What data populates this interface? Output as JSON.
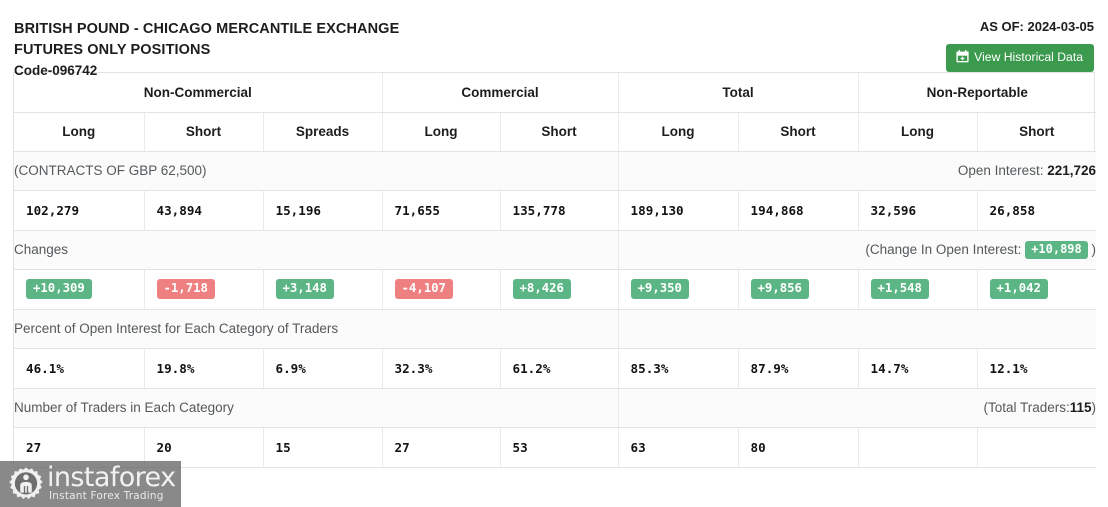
{
  "header": {
    "title_line1": "BRITISH POUND - CHICAGO MERCANTILE EXCHANGE",
    "title_line2": "FUTURES ONLY POSITIONS",
    "code": "Code-096742",
    "as_of": "AS OF: 2024-03-05",
    "history_button": "View Historical Data",
    "accent_green": "#3c9a4e"
  },
  "table": {
    "groups": [
      {
        "label": "Non-Commercial",
        "span": 3
      },
      {
        "label": "Commercial",
        "span": 2
      },
      {
        "label": "Total",
        "span": 2
      },
      {
        "label": "Non-Reportable",
        "span": 2
      }
    ],
    "columns": [
      "Long",
      "Short",
      "Spreads",
      "Long",
      "Short",
      "Long",
      "Short",
      "Long",
      "Short"
    ],
    "contracts_label": "(CONTRACTS OF GBP 62,500)",
    "open_interest_label": "Open Interest:",
    "open_interest_value": "221,726",
    "positions": [
      "102,279",
      "43,894",
      "15,196",
      "71,655",
      "135,778",
      "189,130",
      "194,868",
      "32,596",
      "26,858"
    ],
    "changes_label": "Changes",
    "change_oi_prefix": "(Change In Open Interest:",
    "change_oi_value": "+10,898",
    "change_oi_suffix": ")",
    "changes": [
      {
        "value": "+10,309",
        "sign": "pos"
      },
      {
        "value": "-1,718",
        "sign": "neg"
      },
      {
        "value": "+3,148",
        "sign": "pos"
      },
      {
        "value": "-4,107",
        "sign": "neg"
      },
      {
        "value": "+8,426",
        "sign": "pos"
      },
      {
        "value": "+9,350",
        "sign": "pos"
      },
      {
        "value": "+9,856",
        "sign": "pos"
      },
      {
        "value": "+1,548",
        "sign": "pos"
      },
      {
        "value": "+1,042",
        "sign": "pos"
      }
    ],
    "percent_label": "Percent of Open Interest for Each Category of Traders",
    "percents": [
      "46.1%",
      "19.8%",
      "6.9%",
      "32.3%",
      "61.2%",
      "85.3%",
      "87.9%",
      "14.7%",
      "12.1%"
    ],
    "traders_label": "Number of Traders in Each Category",
    "total_traders_prefix": "(Total Traders:",
    "total_traders_value": "115",
    "total_traders_suffix": ")",
    "traders": [
      "27",
      "20",
      "15",
      "27",
      "53",
      "63",
      "80",
      "",
      ""
    ],
    "badge_positive_color": "#5cb585",
    "badge_negative_color": "#ef8082"
  },
  "watermark": {
    "brand": "instaforex",
    "tagline": "Instant Forex Trading"
  }
}
